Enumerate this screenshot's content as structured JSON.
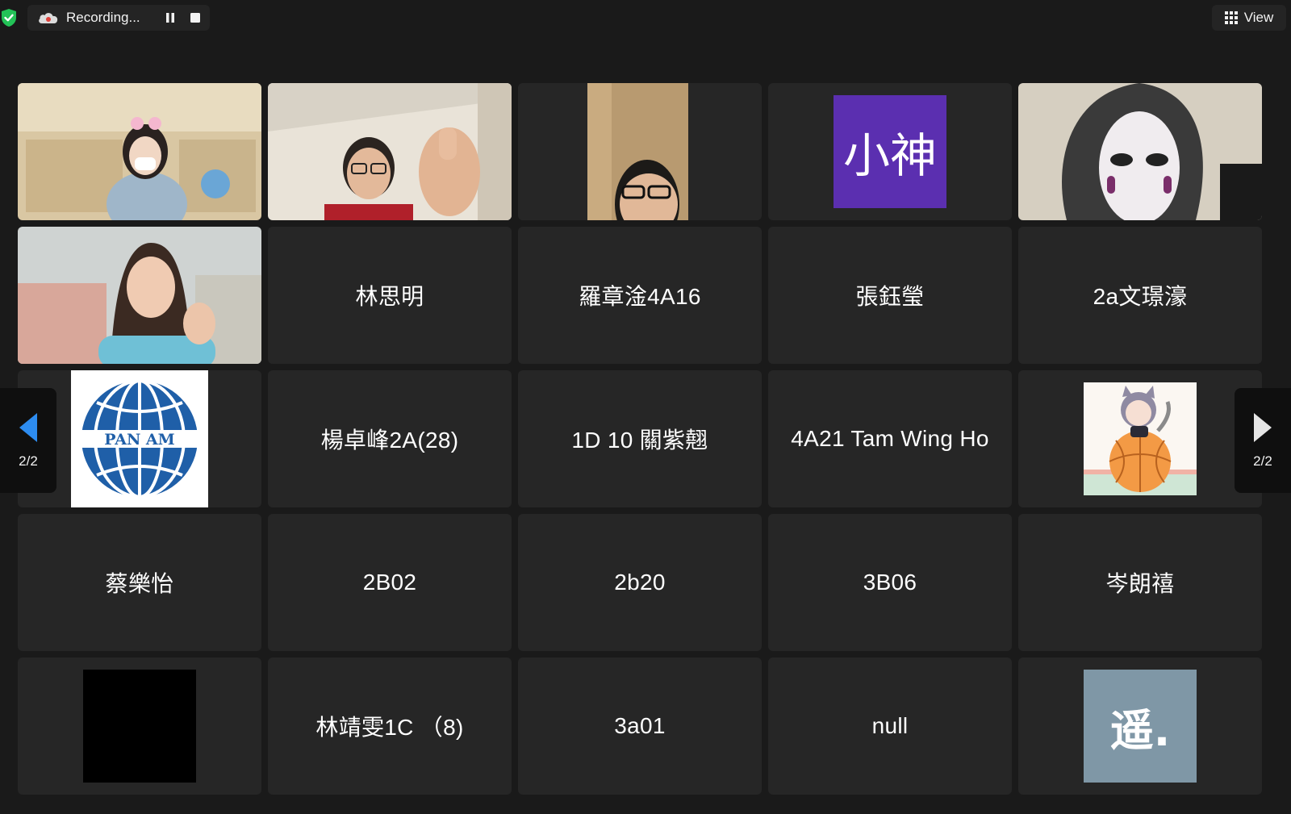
{
  "topbar": {
    "recording_label": "Recording...",
    "view_label": "View",
    "icons": {
      "security": "shield-check-icon",
      "cloud": "cloud-record-icon",
      "pause": "pause-icon",
      "stop": "stop-icon",
      "view": "grid-view-icon"
    }
  },
  "navigation": {
    "left_page": "2/2",
    "right_page": "2/2"
  },
  "tiles": [
    {
      "type": "video"
    },
    {
      "type": "video"
    },
    {
      "type": "video"
    },
    {
      "type": "avatar",
      "avatar_text": "小神",
      "avatar_color": "#5b2fb0"
    },
    {
      "type": "video"
    },
    {
      "type": "video"
    },
    {
      "type": "name",
      "name": "林思明"
    },
    {
      "type": "name",
      "name": "羅章淦4A16"
    },
    {
      "type": "name",
      "name": "張鈺瑩"
    },
    {
      "type": "name",
      "name": "2a文璟濠"
    },
    {
      "type": "image",
      "image_text": "PAN AM"
    },
    {
      "type": "name",
      "name": "楊卓峰2A(28)"
    },
    {
      "type": "name",
      "name": "1D 10 關紫翹"
    },
    {
      "type": "name",
      "name": "4A21 Tam Wing Ho"
    },
    {
      "type": "image"
    },
    {
      "type": "name",
      "name": "蔡樂怡"
    },
    {
      "type": "name",
      "name": "2B02"
    },
    {
      "type": "name",
      "name": "2b20"
    },
    {
      "type": "name",
      "name": "3B06"
    },
    {
      "type": "name",
      "name": "岑朗禧"
    },
    {
      "type": "image"
    },
    {
      "type": "name",
      "name": "林靖雯1C （8)"
    },
    {
      "type": "name",
      "name": "3a01"
    },
    {
      "type": "name",
      "name": "null"
    },
    {
      "type": "avatar",
      "avatar_text": "遥.",
      "avatar_color": "#7f97a6"
    }
  ]
}
